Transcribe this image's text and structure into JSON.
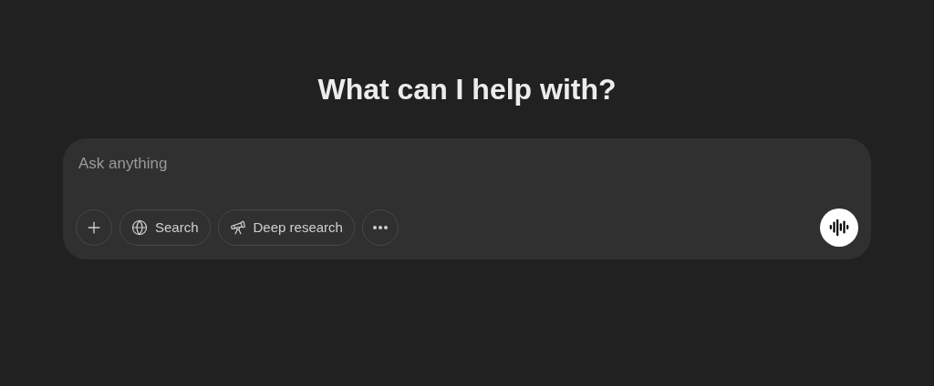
{
  "heading": "What can I help with?",
  "composer": {
    "placeholder": "Ask anything",
    "tools": [
      {
        "kind": "plus"
      },
      {
        "kind": "search",
        "label": "Search"
      },
      {
        "kind": "research",
        "label": "Deep research"
      },
      {
        "kind": "more"
      }
    ]
  }
}
